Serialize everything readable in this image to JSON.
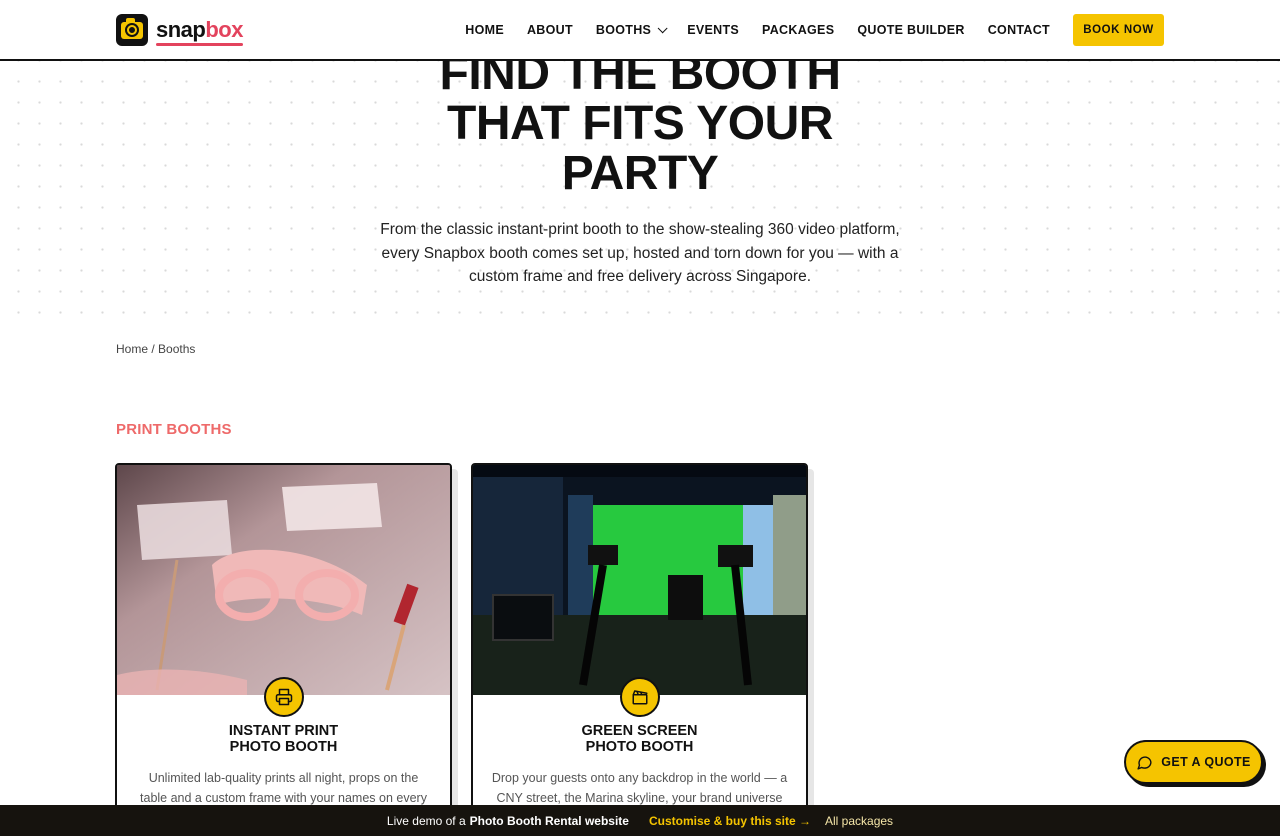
{
  "header": {
    "logo_snap": "snap",
    "logo_box": "box",
    "nav": [
      "HOME",
      "ABOUT",
      "BOOTHS",
      "EVENTS",
      "PACKAGES",
      "QUOTE BUILDER",
      "CONTACT"
    ],
    "book_now": "BOOK NOW"
  },
  "hero": {
    "title_line1": "FIND THE BOOTH",
    "title_line2": "THAT FITS YOUR",
    "title_line3": "PARTY",
    "subtitle": "From the classic instant-print booth to the show-stealing 360 video platform, every Snapbox booth comes set up, hosted and torn down for you — with a custom frame and free delivery across Singapore."
  },
  "breadcrumb": {
    "home": "Home",
    "separator": " / ",
    "current": "Booths"
  },
  "section": {
    "title": "PRINT BOOTHS"
  },
  "cards": [
    {
      "name_line1": "INSTANT PRINT",
      "name_line2": "PHOTO BOOTH",
      "desc": "Unlimited lab-quality prints all night, props on the table and a custom frame with your names on every strip.",
      "icon": "printer-icon"
    },
    {
      "name_line1": "GREEN SCREEN",
      "name_line2": "PHOTO BOOTH",
      "desc": "Drop your guests onto any backdrop in the world — a CNY street, the Marina skyline, your brand universe —",
      "icon": "clapperboard-icon"
    }
  ],
  "quote_button": "GET A QUOTE",
  "demo_bar": {
    "prefix": "Live demo of a",
    "site": "Photo Booth Rental website",
    "customise": "Customise & buy this site →",
    "all": "All packages"
  },
  "colors": {
    "accent_yellow": "#f5c400",
    "accent_pink": "#e3435d",
    "section_coral": "#ee6a6a",
    "dark": "#111111"
  }
}
